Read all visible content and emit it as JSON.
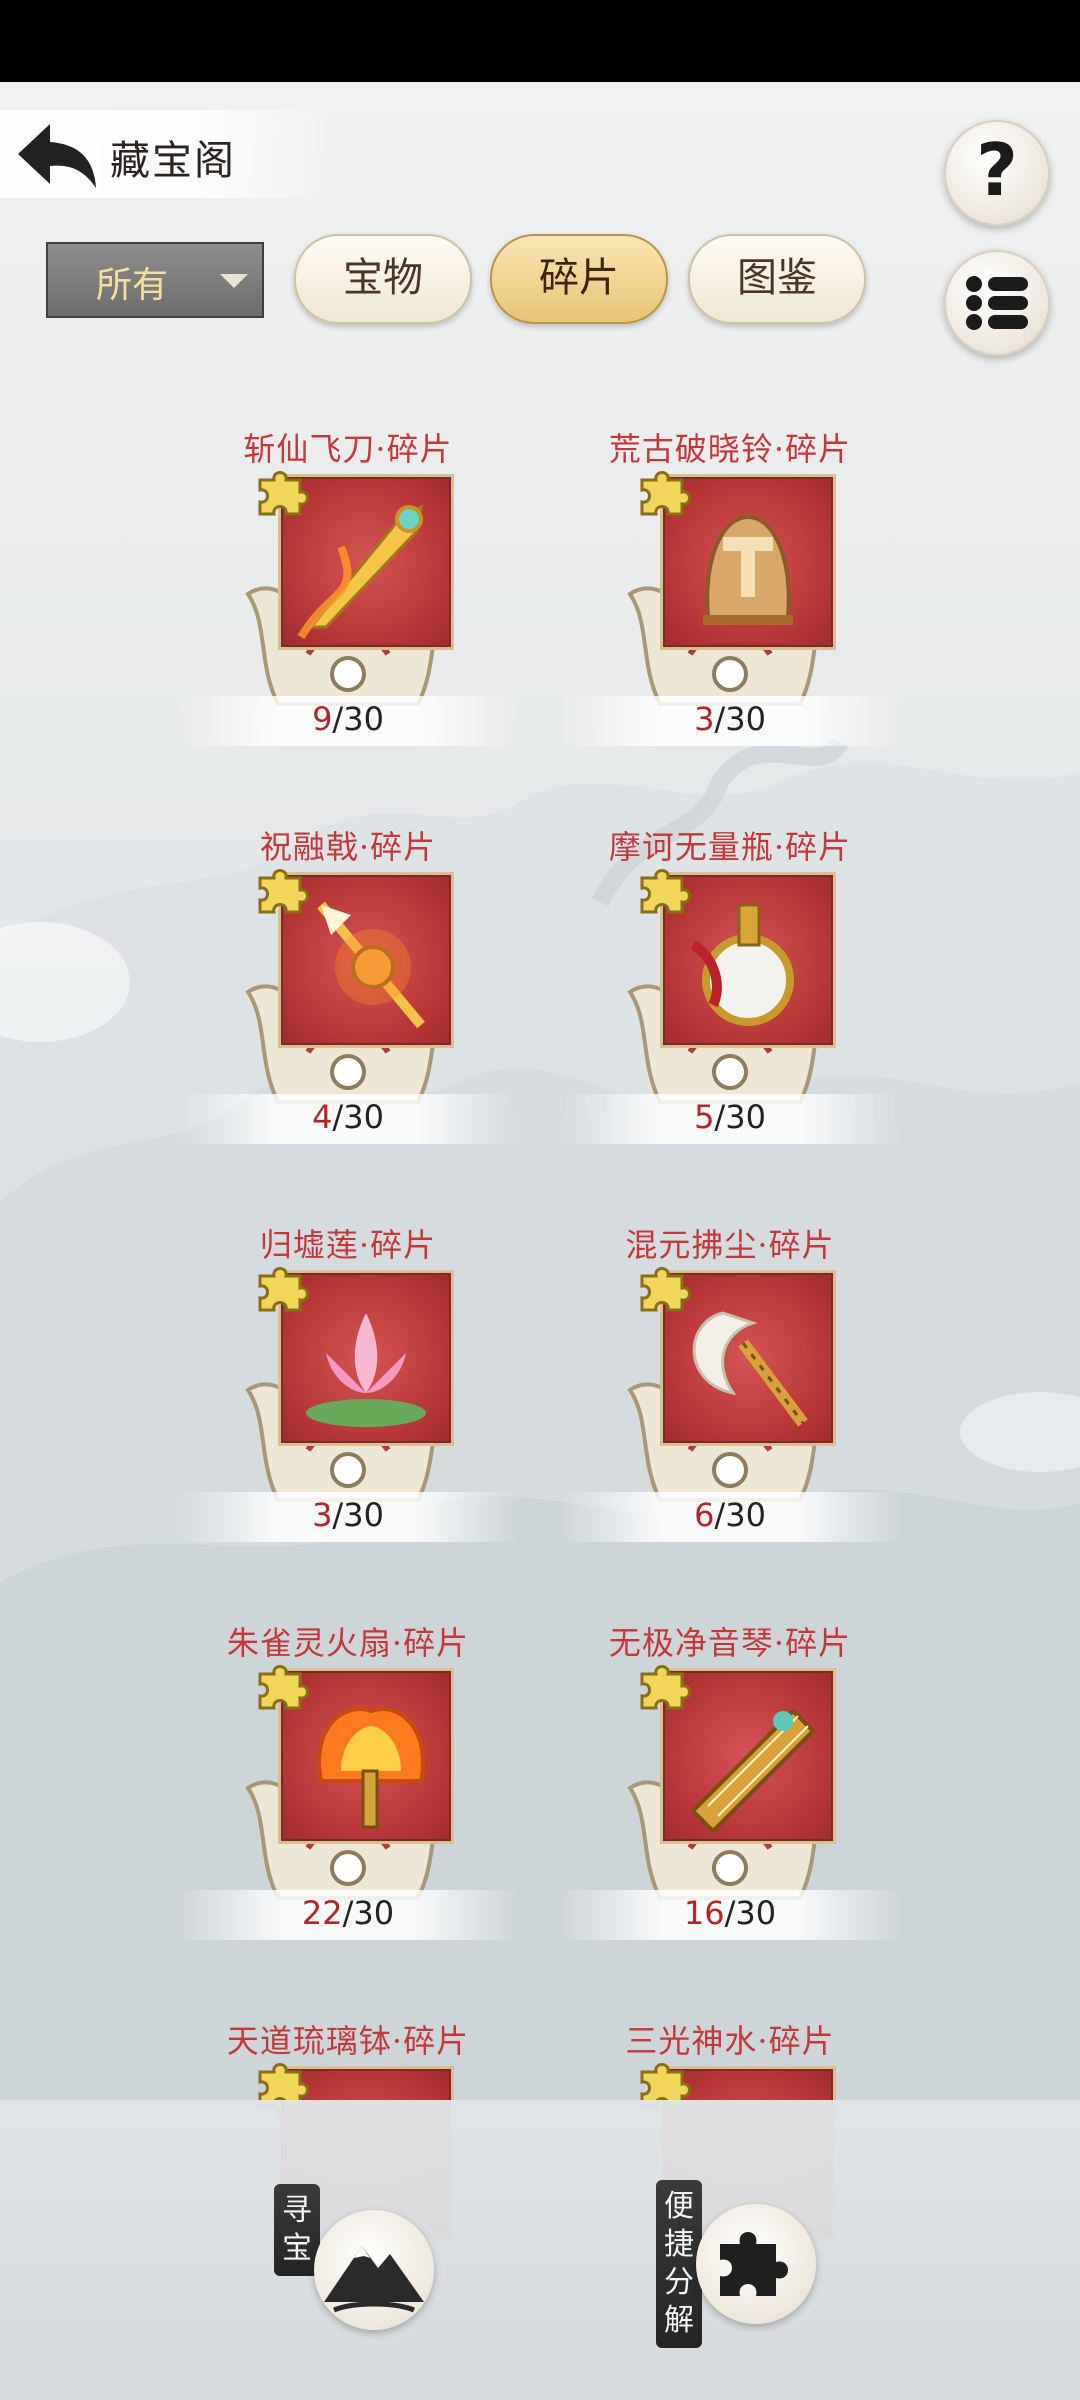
{
  "header": {
    "title": "藏宝阁",
    "help_symbol": "?"
  },
  "filter": {
    "selected": "所有"
  },
  "tabs": [
    {
      "label": "宝物",
      "active": false
    },
    {
      "label": "碎片",
      "active": true
    },
    {
      "label": "图鉴",
      "active": false
    }
  ],
  "fragments": [
    {
      "name": "斩仙飞刀·碎片",
      "have": "9",
      "total": "/30",
      "icon": "golden-flying-blade"
    },
    {
      "name": "荒古破晓铃·碎片",
      "have": "3",
      "total": "/30",
      "icon": "ancient-bell"
    },
    {
      "name": "祝融戟·碎片",
      "have": "4",
      "total": "/30",
      "icon": "fire-halberd"
    },
    {
      "name": "摩诃无量瓶·碎片",
      "have": "5",
      "total": "/30",
      "icon": "infinite-vase"
    },
    {
      "name": "归墟莲·碎片",
      "have": "3",
      "total": "/30",
      "icon": "lotus"
    },
    {
      "name": "混元拂尘·碎片",
      "have": "6",
      "total": "/30",
      "icon": "whisk"
    },
    {
      "name": "朱雀灵火扇·碎片",
      "have": "22",
      "total": "/30",
      "icon": "phoenix-fire-fan"
    },
    {
      "name": "无极净音琴·碎片",
      "have": "16",
      "total": "/30",
      "icon": "zither"
    },
    {
      "name": "天道琉璃钵·碎片",
      "have": "",
      "total": "",
      "icon": "glass-bowl"
    },
    {
      "name": "三光神水·碎片",
      "have": "",
      "total": "",
      "icon": "divine-water"
    }
  ],
  "bottom": {
    "seek_treasure": {
      "label_chars": [
        "寻",
        "宝"
      ],
      "icon": "mountain-icon"
    },
    "quick_decompose": {
      "label_chars": [
        "便",
        "捷",
        "分",
        "解"
      ],
      "icon": "puzzle-icon"
    }
  },
  "colors": {
    "name_red": "#c4383c",
    "count_red": "#b0262b",
    "frame_red": "#b63536",
    "tab_active": "#e6c476",
    "filter_text": "#f7de9c"
  }
}
